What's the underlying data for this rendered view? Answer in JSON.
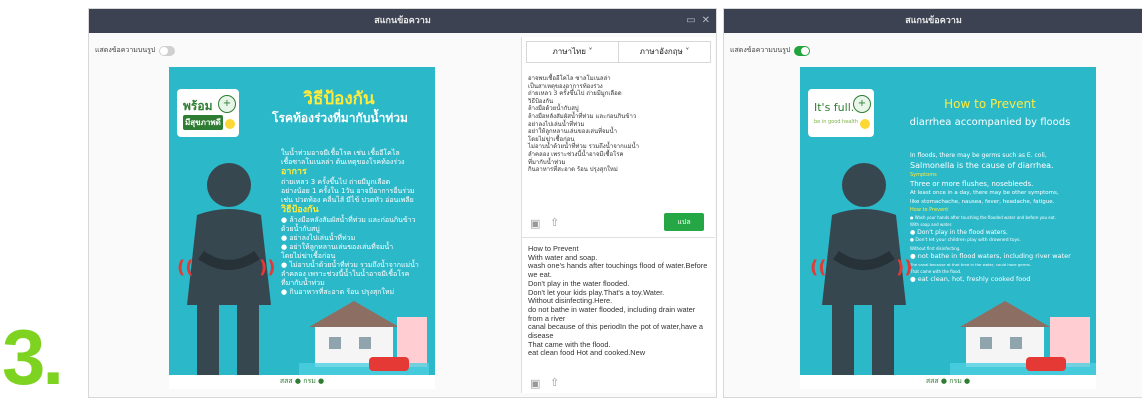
{
  "step_label": "3.",
  "window_left": {
    "title": "สแกนข้อความ",
    "title_icons": [
      "minimize-icon",
      "close-icon"
    ],
    "toggle_label": "แสดงข้อความบนรูป",
    "toggle_on": false,
    "poster": {
      "logo_main": "พร้อม",
      "logo_sub": "มีสุขภาพดี",
      "title": "วิธีป้องกัน",
      "subtitle": "โรคท้องร่วงที่มากับน้ำท่วม",
      "body": [
        {
          "t": "ในน้ำท่วมอาจมีเชื้อโรค เช่น เชื้ออีโคไล",
          "y": false
        },
        {
          "t": "เชื้อซาลโมเนลล่า ต้นเหตุของโรคท้องร่วง",
          "y": false
        },
        {
          "t": "อาการ",
          "y": true
        },
        {
          "t": "ถ่ายเหลว 3 ครั้งขึ้นไป ถ่ายมีมูกเลือด",
          "y": false
        },
        {
          "t": "อย่างน้อย 1 ครั้งใน 1วัน อาจมีอาการอื่นร่วม",
          "y": false
        },
        {
          "t": "เช่น ปวดท้อง คลื่นไส้ มีไข้ ปวดหัว อ่อนเพลีย",
          "y": false
        },
        {
          "t": "วิธีป้องกัน",
          "y": true
        },
        {
          "t": "● ล้างมือหลังสัมผัสน้ำที่ท่วม และก่อนกินข้าว",
          "y": false
        },
        {
          "t": "  ด้วยน้ำกับสบู่",
          "y": false
        },
        {
          "t": "● อย่าลงไปเล่นน้ำที่ท่วม",
          "y": false
        },
        {
          "t": "● อย่าให้ลูกหลานเล่นของเล่นที่จมน้ำ",
          "y": false
        },
        {
          "t": "  โดยไม่ฆ่าเชื้อก่อน",
          "y": false
        },
        {
          "t": "● ไม่อาบน้ำด้วยน้ำที่ท่วม รวมถึงน้ำจากแม่น้ำ",
          "y": false
        },
        {
          "t": "  ลำคลอง เพราะช่วงนี้น้ำในน้ำอาจมีเชื้อโรค",
          "y": false
        },
        {
          "t": "  ที่มากับน้ำท่วม",
          "y": false
        },
        {
          "t": "● กินอาหารที่สะอาด ร้อน ปรุงสุกใหม่",
          "y": false
        }
      ],
      "footer": "สสส ● กรม ●"
    },
    "translator": {
      "lang_from": "ภาษาไทย ˅",
      "lang_to": "ภาษาอังกฤษ ˅",
      "source_lines": [
        "อาจพบเชื้ออีโคไล ซาลโมเนลล่า",
        "เป็นสาเหตุของอาการท้องร่วง",
        "ถ่ายเหลว 3 ครั้งขึ้นไป ถ่ายมีมูกเลือด",
        "วิธีป้องกัน",
        "ล้างมือด้วยน้ำกับสบู่",
        "ล้างมือหลังสัมผัสน้ำที่ท่วม และก่อนกินข้าว",
        "อย่าลงไปเล่นน้ำที่ท่วม",
        "อย่าให้ลูกหลานเล่นของเล่นที่จมน้ำ",
        "โดยไม่ฆ่าเชื้อก่อน",
        "ไม่อาบน้ำด้วยน้ำที่ท่วม รวมถึงน้ำจากแม่น้ำ",
        "ลำคลอง เพราะช่วงนี้น้ำอาจมีเชื้อโรค",
        "ที่มากับน้ำท่วม",
        "กินอาหารที่สะอาด ร้อน ปรุงสุกใหม่"
      ],
      "translate_label": "แปล",
      "output_lines": [
        "How to Prevent",
        "With water and soap.",
        "wash one's hands after touchings flood of water.Before",
        "we eat.",
        "Don't play in the water flooded.",
        "Don't let your kids play.That's a toy.Water.",
        "Without disinfecting.Here.",
        "do not bathe in water flooded, including drain water",
        "from a river",
        "canal because of this periodIn the pot of water,have a",
        "disease",
        "That came with the flood.",
        "eat clean food Hot and cooked.New"
      ]
    }
  },
  "window_right": {
    "title": "สแกนข้อความ",
    "toggle_label": "แสดงข้อความบนรูป",
    "toggle_on": true,
    "poster": {
      "logo_main": "It's full.",
      "logo_sub": "be in good health",
      "title": "How to Prevent",
      "subtitle": "diarrhea accompanied by floods",
      "body": [
        {
          "t": "In floods, there may be germs such as E. coli,",
          "c": "w",
          "s": 6
        },
        {
          "t": "Salmonella is the cause of diarrhea.",
          "c": "w",
          "s": 8
        },
        {
          "t": "Symptoms",
          "c": "y",
          "s": 5
        },
        {
          "t": "Three or more flushes, nosebleeds.",
          "c": "w",
          "s": 7
        },
        {
          "t": "At least once in a day, there may be other symptoms,",
          "c": "w",
          "s": 5.5
        },
        {
          "t": "like stomachache, nausea, fever, headache, fatigue.",
          "c": "w",
          "s": 5.5
        },
        {
          "t": "How to Prevent",
          "c": "y",
          "s": 5
        },
        {
          "t": "● Wash your hands after touching the flooded water and before you eat.",
          "c": "w",
          "s": 4
        },
        {
          "t": "With soap and water.",
          "c": "w",
          "s": 4
        },
        {
          "t": "● Don't play in the flood waters.",
          "c": "w",
          "s": 6
        },
        {
          "t": "● Don't let your children play with drowned toys.",
          "c": "w",
          "s": 4.5
        },
        {
          "t": "Without first disinfecting.",
          "c": "w",
          "s": 4
        },
        {
          "t": "● not bathe in flood waters, including river water",
          "c": "w",
          "s": 6.5
        },
        {
          "t": "The canal because at that time in the water, could have germs.",
          "c": "w",
          "s": 3.8
        },
        {
          "t": "That came with the flood.",
          "c": "w",
          "s": 4
        },
        {
          "t": "● eat clean, hot, freshly cooked food",
          "c": "w",
          "s": 6.5
        }
      ],
      "footer": "สสส ● กรม ●"
    }
  }
}
